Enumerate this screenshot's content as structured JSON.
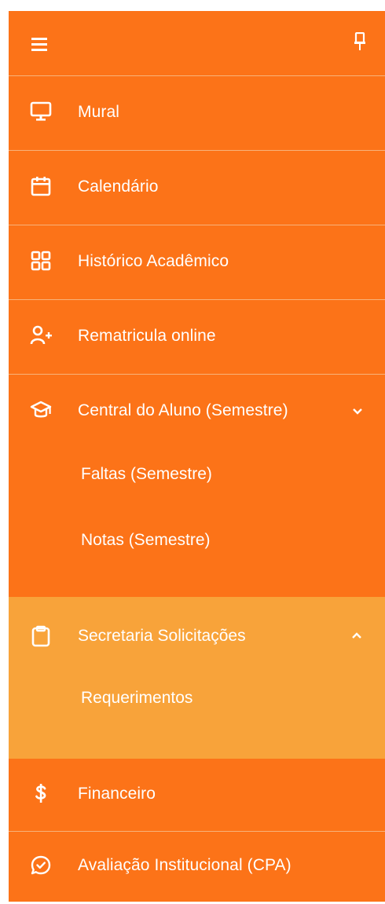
{
  "menu": {
    "items": [
      {
        "id": "mural",
        "label": "Mural",
        "icon": "monitor-icon"
      },
      {
        "id": "calendario",
        "label": "Calendário",
        "icon": "calendar-icon"
      },
      {
        "id": "historico",
        "label": "Histórico Acadêmico",
        "icon": "grid-icon"
      },
      {
        "id": "rematricula",
        "label": "Rematricula online",
        "icon": "user-plus-icon"
      },
      {
        "id": "central",
        "label": "Central do Aluno (Semestre)",
        "icon": "graduation-cap-icon",
        "expanded": true,
        "children": [
          {
            "label": "Faltas (Semestre)"
          },
          {
            "label": "Notas (Semestre)"
          }
        ]
      },
      {
        "id": "secretaria",
        "label": "Secretaria Solicitações",
        "icon": "clipboard-icon",
        "expanded": true,
        "active": true,
        "children": [
          {
            "label": "Requerimentos"
          }
        ]
      },
      {
        "id": "financeiro",
        "label": "Financeiro",
        "icon": "dollar-icon"
      },
      {
        "id": "avaliacao",
        "label": "Avaliação Institucional (CPA)",
        "icon": "chat-check-icon"
      }
    ]
  },
  "colors": {
    "primary": "#fc7318",
    "active": "#f8a33a",
    "divider": "#f8b27a",
    "text": "#ffffff"
  }
}
